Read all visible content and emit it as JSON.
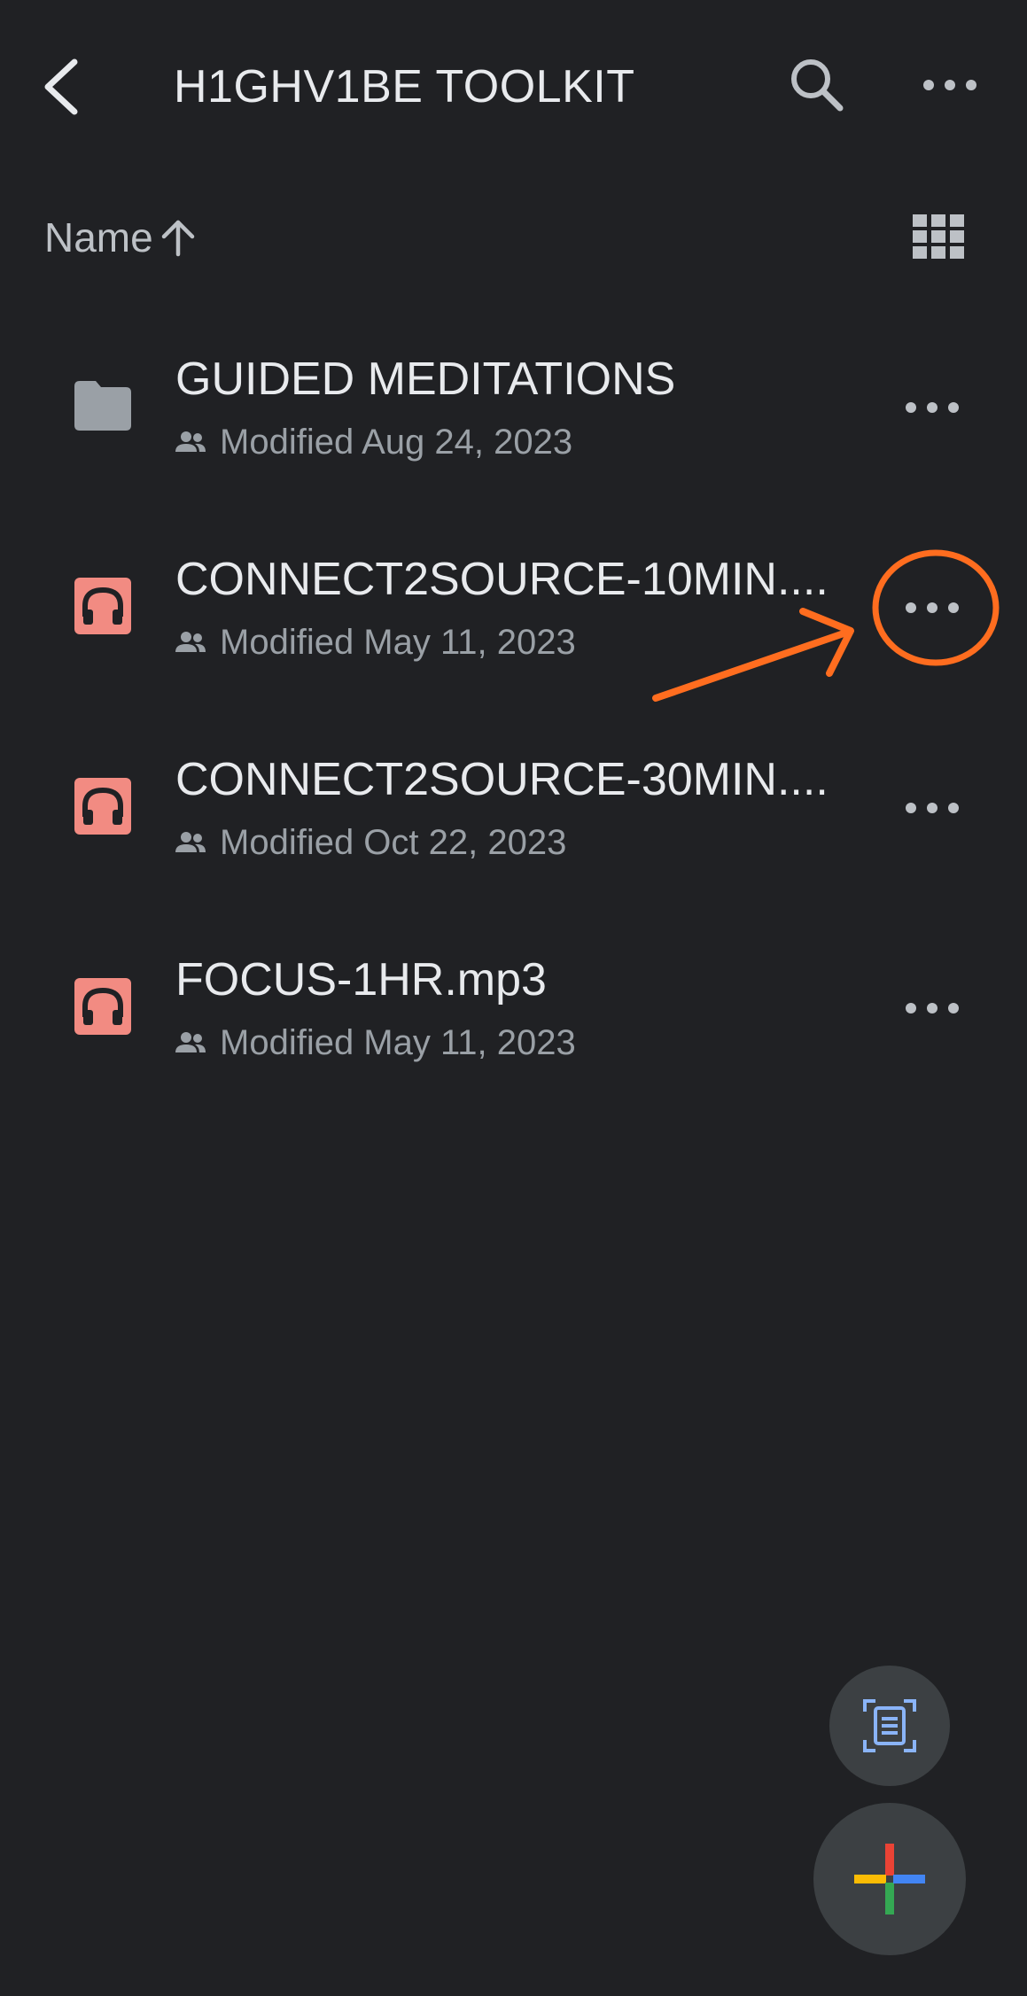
{
  "header": {
    "title": "H1GHV1BE TOOLKIT",
    "back_icon": "chevron-left-icon",
    "search_icon": "search-icon",
    "more_icon": "more-horizontal-icon"
  },
  "sort": {
    "label": "Name",
    "direction_icon": "arrow-up-icon",
    "view_toggle_icon": "grid-view-icon"
  },
  "files": [
    {
      "type": "folder",
      "icon": "folder-icon",
      "name": "GUIDED MEDITATIONS",
      "modified": "Modified Aug 24, 2023",
      "shared": true
    },
    {
      "type": "audio",
      "icon": "headphones-icon",
      "name": "CONNECT2SOURCE-10MIN....",
      "modified": "Modified May 11, 2023",
      "shared": true,
      "highlighted": true
    },
    {
      "type": "audio",
      "icon": "headphones-icon",
      "name": "CONNECT2SOURCE-30MIN....",
      "modified": "Modified Oct 22, 2023",
      "shared": true
    },
    {
      "type": "audio",
      "icon": "headphones-icon",
      "name": "FOCUS-1HR.mp3",
      "modified": "Modified May 11, 2023",
      "shared": true
    }
  ],
  "annotation": {
    "color": "#ff6d1f",
    "target": "more-options on row 2",
    "shapes": [
      "circle",
      "arrow"
    ]
  },
  "fabs": {
    "scan_icon": "document-scan-icon",
    "new_icon": "plus-multicolor-icon"
  },
  "colors": {
    "background": "#202124",
    "text_primary": "#e8eaed",
    "text_secondary": "#9aa0a6",
    "audio_icon": "#f28b82",
    "folder_icon": "#9aa0a6",
    "fab": "#3c4043",
    "scan_blue": "#8ab4f8",
    "plus_red": "#ea4335",
    "plus_yellow": "#fbbc04",
    "plus_green": "#34a853",
    "plus_blue": "#4285f4"
  }
}
